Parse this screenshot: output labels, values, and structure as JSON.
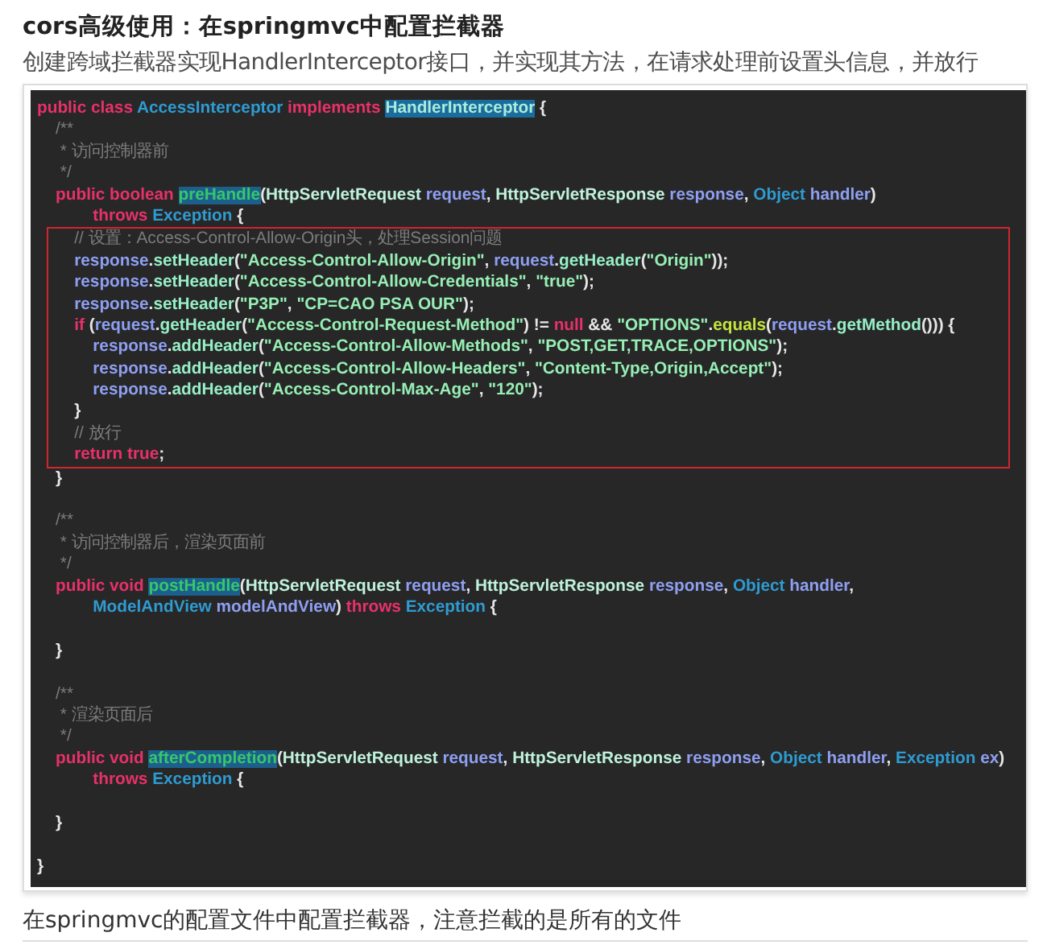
{
  "heading": "cors高级使用：在springmvc中配置拦截器",
  "intro": "创建跨域拦截器实现HandlerInterceptor接口，并实现其方法，在请求处理前设置头信息，并放行",
  "code_blocks": [
    {
      "boxed": false,
      "lines": [
        {
          "kind": "code",
          "tokens": [
            {
              "kind": "kw",
              "text": "public class "
            },
            {
              "kind": "type",
              "text": "AccessInterceptor "
            },
            {
              "kind": "kw",
              "text": "implements "
            },
            {
              "kind": "sel-type",
              "text": "HandlerInterceptor"
            },
            {
              "kind": "p",
              "text": " {"
            }
          ]
        },
        {
          "kind": "code",
          "tokens": [
            {
              "kind": "cmt",
              "text": "    /**"
            }
          ]
        },
        {
          "kind": "code",
          "tokens": [
            {
              "kind": "cmt",
              "text": "     * 访问控制器前"
            }
          ]
        },
        {
          "kind": "code",
          "tokens": [
            {
              "kind": "cmt",
              "text": "     */"
            }
          ]
        },
        {
          "kind": "code",
          "tokens": [
            {
              "kind": "kw",
              "text": "    public boolean "
            },
            {
              "kind": "sel-fn",
              "text": "preHandle"
            },
            {
              "kind": "p",
              "text": "("
            },
            {
              "kind": "cls",
              "text": "HttpServletRequest "
            },
            {
              "kind": "var",
              "text": "request"
            },
            {
              "kind": "p",
              "text": ", "
            },
            {
              "kind": "cls",
              "text": "HttpServletResponse "
            },
            {
              "kind": "var",
              "text": "response"
            },
            {
              "kind": "p",
              "text": ", "
            },
            {
              "kind": "type",
              "text": "Object "
            },
            {
              "kind": "var",
              "text": "handler"
            },
            {
              "kind": "p",
              "text": ")"
            }
          ]
        },
        {
          "kind": "code",
          "tokens": [
            {
              "kind": "kw",
              "text": "            throws "
            },
            {
              "kind": "type",
              "text": "Exception "
            },
            {
              "kind": "p",
              "text": "{"
            }
          ]
        }
      ]
    },
    {
      "boxed": true,
      "lines": [
        {
          "kind": "code",
          "tokens": [
            {
              "kind": "cmt",
              "text": "        // 设置：Access-Control-Allow-Origin头，处理Session问题"
            }
          ]
        },
        {
          "kind": "code",
          "tokens": [
            {
              "kind": "var",
              "text": "        response"
            },
            {
              "kind": "p",
              "text": "."
            },
            {
              "kind": "fn",
              "text": "setHeader"
            },
            {
              "kind": "p",
              "text": "("
            },
            {
              "kind": "str",
              "text": "\"Access-Control-Allow-Origin\""
            },
            {
              "kind": "p",
              "text": ", "
            },
            {
              "kind": "var",
              "text": "request"
            },
            {
              "kind": "p",
              "text": "."
            },
            {
              "kind": "fn",
              "text": "getHeader"
            },
            {
              "kind": "p",
              "text": "("
            },
            {
              "kind": "str",
              "text": "\"Origin\""
            },
            {
              "kind": "p",
              "text": "));"
            }
          ]
        },
        {
          "kind": "code",
          "tokens": [
            {
              "kind": "var",
              "text": "        response"
            },
            {
              "kind": "p",
              "text": "."
            },
            {
              "kind": "fn",
              "text": "setHeader"
            },
            {
              "kind": "p",
              "text": "("
            },
            {
              "kind": "str",
              "text": "\"Access-Control-Allow-Credentials\""
            },
            {
              "kind": "p",
              "text": ", "
            },
            {
              "kind": "str",
              "text": "\"true\""
            },
            {
              "kind": "p",
              "text": ");"
            }
          ]
        },
        {
          "kind": "code",
          "tokens": [
            {
              "kind": "var",
              "text": "        response"
            },
            {
              "kind": "p",
              "text": "."
            },
            {
              "kind": "fn",
              "text": "setHeader"
            },
            {
              "kind": "p",
              "text": "("
            },
            {
              "kind": "str",
              "text": "\"P3P\""
            },
            {
              "kind": "p",
              "text": ", "
            },
            {
              "kind": "str",
              "text": "\"CP=CAO PSA OUR\""
            },
            {
              "kind": "p",
              "text": ");"
            }
          ]
        },
        {
          "kind": "code",
          "tokens": [
            {
              "kind": "kw",
              "text": "        if "
            },
            {
              "kind": "p",
              "text": "("
            },
            {
              "kind": "var",
              "text": "request"
            },
            {
              "kind": "p",
              "text": "."
            },
            {
              "kind": "fn",
              "text": "getHeader"
            },
            {
              "kind": "p",
              "text": "("
            },
            {
              "kind": "str",
              "text": "\"Access-Control-Request-Method\""
            },
            {
              "kind": "p",
              "text": ") != "
            },
            {
              "kind": "kw",
              "text": "null "
            },
            {
              "kind": "p",
              "text": "&& "
            },
            {
              "kind": "str",
              "text": "\"OPTIONS\""
            },
            {
              "kind": "p",
              "text": "."
            },
            {
              "kind": "fn2",
              "text": "equals"
            },
            {
              "kind": "p",
              "text": "("
            },
            {
              "kind": "var",
              "text": "request"
            },
            {
              "kind": "p",
              "text": "."
            },
            {
              "kind": "fn",
              "text": "getMethod"
            },
            {
              "kind": "p",
              "text": "())) {"
            }
          ]
        },
        {
          "kind": "code",
          "tokens": [
            {
              "kind": "var",
              "text": "            response"
            },
            {
              "kind": "p",
              "text": "."
            },
            {
              "kind": "fn",
              "text": "addHeader"
            },
            {
              "kind": "p",
              "text": "("
            },
            {
              "kind": "str",
              "text": "\"Access-Control-Allow-Methods\""
            },
            {
              "kind": "p",
              "text": ", "
            },
            {
              "kind": "str",
              "text": "\"POST,GET,TRACE,OPTIONS\""
            },
            {
              "kind": "p",
              "text": ");"
            }
          ]
        },
        {
          "kind": "code",
          "tokens": [
            {
              "kind": "var",
              "text": "            response"
            },
            {
              "kind": "p",
              "text": "."
            },
            {
              "kind": "fn",
              "text": "addHeader"
            },
            {
              "kind": "p",
              "text": "("
            },
            {
              "kind": "str",
              "text": "\"Access-Control-Allow-Headers\""
            },
            {
              "kind": "p",
              "text": ", "
            },
            {
              "kind": "str",
              "text": "\"Content-Type,Origin,Accept\""
            },
            {
              "kind": "p",
              "text": ");"
            }
          ]
        },
        {
          "kind": "code",
          "tokens": [
            {
              "kind": "var",
              "text": "            response"
            },
            {
              "kind": "p",
              "text": "."
            },
            {
              "kind": "fn",
              "text": "addHeader"
            },
            {
              "kind": "p",
              "text": "("
            },
            {
              "kind": "str",
              "text": "\"Access-Control-Max-Age\""
            },
            {
              "kind": "p",
              "text": ", "
            },
            {
              "kind": "str",
              "text": "\"120\""
            },
            {
              "kind": "p",
              "text": ");"
            }
          ]
        },
        {
          "kind": "code",
          "tokens": [
            {
              "kind": "p",
              "text": "        }"
            }
          ]
        },
        {
          "kind": "code",
          "tokens": [
            {
              "kind": "cmt",
              "text": "        // 放行"
            }
          ]
        },
        {
          "kind": "code",
          "tokens": [
            {
              "kind": "kw",
              "text": "        return true"
            },
            {
              "kind": "p",
              "text": ";"
            }
          ]
        }
      ]
    },
    {
      "boxed": false,
      "lines": [
        {
          "kind": "code",
          "tokens": [
            {
              "kind": "p",
              "text": "    }"
            }
          ]
        },
        {
          "kind": "blank"
        },
        {
          "kind": "code",
          "tokens": [
            {
              "kind": "cmt",
              "text": "    /**"
            }
          ]
        },
        {
          "kind": "code",
          "tokens": [
            {
              "kind": "cmt",
              "text": "     * 访问控制器后，渲染页面前"
            }
          ]
        },
        {
          "kind": "code",
          "tokens": [
            {
              "kind": "cmt",
              "text": "     */"
            }
          ]
        },
        {
          "kind": "code",
          "tokens": [
            {
              "kind": "kw",
              "text": "    public void "
            },
            {
              "kind": "sel-fn",
              "text": "postHandle"
            },
            {
              "kind": "p",
              "text": "("
            },
            {
              "kind": "cls",
              "text": "HttpServletRequest "
            },
            {
              "kind": "var",
              "text": "request"
            },
            {
              "kind": "p",
              "text": ", "
            },
            {
              "kind": "cls",
              "text": "HttpServletResponse "
            },
            {
              "kind": "var",
              "text": "response"
            },
            {
              "kind": "p",
              "text": ", "
            },
            {
              "kind": "type",
              "text": "Object "
            },
            {
              "kind": "var",
              "text": "handler"
            },
            {
              "kind": "p",
              "text": ","
            }
          ]
        },
        {
          "kind": "code",
          "tokens": [
            {
              "kind": "type",
              "text": "            ModelAndView "
            },
            {
              "kind": "var",
              "text": "modelAndView"
            },
            {
              "kind": "p",
              "text": ") "
            },
            {
              "kind": "kw",
              "text": "throws "
            },
            {
              "kind": "type",
              "text": "Exception "
            },
            {
              "kind": "p",
              "text": "{"
            }
          ]
        },
        {
          "kind": "blank"
        },
        {
          "kind": "code",
          "tokens": [
            {
              "kind": "p",
              "text": "    }"
            }
          ]
        },
        {
          "kind": "blank"
        },
        {
          "kind": "code",
          "tokens": [
            {
              "kind": "cmt",
              "text": "    /**"
            }
          ]
        },
        {
          "kind": "code",
          "tokens": [
            {
              "kind": "cmt",
              "text": "     * 渲染页面后"
            }
          ]
        },
        {
          "kind": "code",
          "tokens": [
            {
              "kind": "cmt",
              "text": "     */"
            }
          ]
        },
        {
          "kind": "code",
          "tokens": [
            {
              "kind": "kw",
              "text": "    public void "
            },
            {
              "kind": "sel-fn",
              "text": "afterCompletion"
            },
            {
              "kind": "p",
              "text": "("
            },
            {
              "kind": "cls",
              "text": "HttpServletRequest "
            },
            {
              "kind": "var",
              "text": "request"
            },
            {
              "kind": "p",
              "text": ", "
            },
            {
              "kind": "cls",
              "text": "HttpServletResponse "
            },
            {
              "kind": "var",
              "text": "response"
            },
            {
              "kind": "p",
              "text": ", "
            },
            {
              "kind": "type",
              "text": "Object "
            },
            {
              "kind": "var",
              "text": "handler"
            },
            {
              "kind": "p",
              "text": ", "
            },
            {
              "kind": "type",
              "text": "Exception "
            },
            {
              "kind": "var",
              "text": "ex"
            },
            {
              "kind": "p",
              "text": ")"
            }
          ]
        },
        {
          "kind": "code",
          "tokens": [
            {
              "kind": "kw",
              "text": "            throws "
            },
            {
              "kind": "type",
              "text": "Exception "
            },
            {
              "kind": "p",
              "text": "{"
            }
          ]
        },
        {
          "kind": "blank"
        },
        {
          "kind": "code",
          "tokens": [
            {
              "kind": "p",
              "text": "    }"
            }
          ]
        },
        {
          "kind": "blank"
        },
        {
          "kind": "code",
          "tokens": [
            {
              "kind": "p",
              "text": "}"
            }
          ]
        }
      ]
    }
  ],
  "outro": "在springmvc的配置文件中配置拦截器，注意拦截的是所有的文件"
}
